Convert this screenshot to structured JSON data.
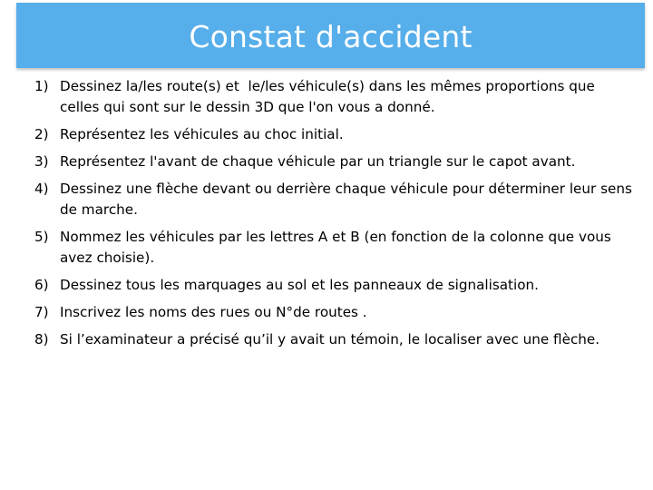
{
  "header": {
    "title": "Constat d'accident"
  },
  "steps": [
    {
      "num": "1)",
      "text": "Dessinez la/les route(s) et  le/les véhicule(s) dans les mêmes proportions que celles qui sont sur le dessin 3D que l'on vous a donné."
    },
    {
      "num": "2)",
      "text": "Représentez les véhicules au choc initial."
    },
    {
      "num": "3)",
      "text": "Représentez l'avant de chaque véhicule par un triangle sur le capot avant."
    },
    {
      "num": "4)",
      "text": "Dessinez une flèche devant ou derrière chaque véhicule pour déterminer leur sens de marche."
    },
    {
      "num": "5)",
      "text": "Nommez les véhicules par les lettres A et B (en fonction de la colonne que vous avez choisie)."
    },
    {
      "num": "6)",
      "text": "Dessinez tous les marquages au sol et les panneaux de signalisation."
    },
    {
      "num": "7)",
      "text": "Inscrivez les noms des rues ou N°de routes ."
    },
    {
      "num": "8)",
      "text": "Si l’examinateur a précisé qu’il y avait un témoin, le localiser avec une flèche."
    }
  ]
}
